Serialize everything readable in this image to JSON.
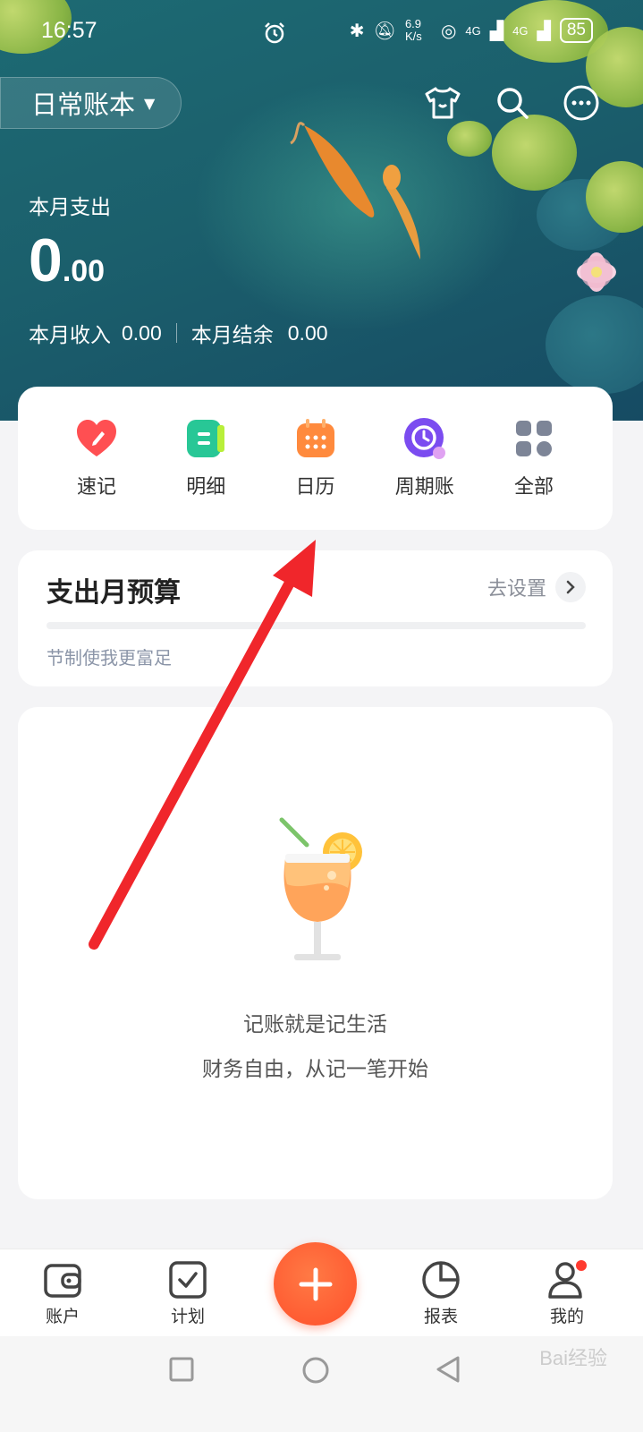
{
  "status_bar": {
    "time": "16:57",
    "net_speed": "6.9 K/s",
    "signal1": "4G",
    "signal2": "4G",
    "battery": "85"
  },
  "header": {
    "book_name": "日常账本",
    "icons": [
      "skin-icon",
      "search-icon",
      "more-icon"
    ],
    "month_expense_label": "本月支出",
    "month_expense_int": "0",
    "month_expense_dec": ".00",
    "income_label": "本月收入",
    "income_value": "0.00",
    "balance_label": "本月结余",
    "balance_value": "0.00"
  },
  "quick_actions": [
    {
      "label": "速记",
      "icon": "heart-pencil-icon",
      "color": "#ff4f4f"
    },
    {
      "label": "明细",
      "icon": "list-icon",
      "color": "#2ecc9a"
    },
    {
      "label": "日历",
      "icon": "calendar-icon",
      "color": "#ff8a3d"
    },
    {
      "label": "周期账",
      "icon": "cycle-clock-icon",
      "color": "#7d4cf0"
    },
    {
      "label": "全部",
      "icon": "grid-icon",
      "color": "#7d8597"
    }
  ],
  "budget": {
    "title": "支出月预算",
    "action": "去设置",
    "progress": 0,
    "hint": "节制使我更富足"
  },
  "empty_state": {
    "line1": "记账就是记生活",
    "line2": "财务自由，从记一笔开始"
  },
  "bottom_nav": {
    "items": [
      {
        "label": "账户"
      },
      {
        "label": "计划"
      },
      {
        "label": "报表"
      },
      {
        "label": "我的"
      }
    ]
  },
  "watermark": "Bai经验"
}
